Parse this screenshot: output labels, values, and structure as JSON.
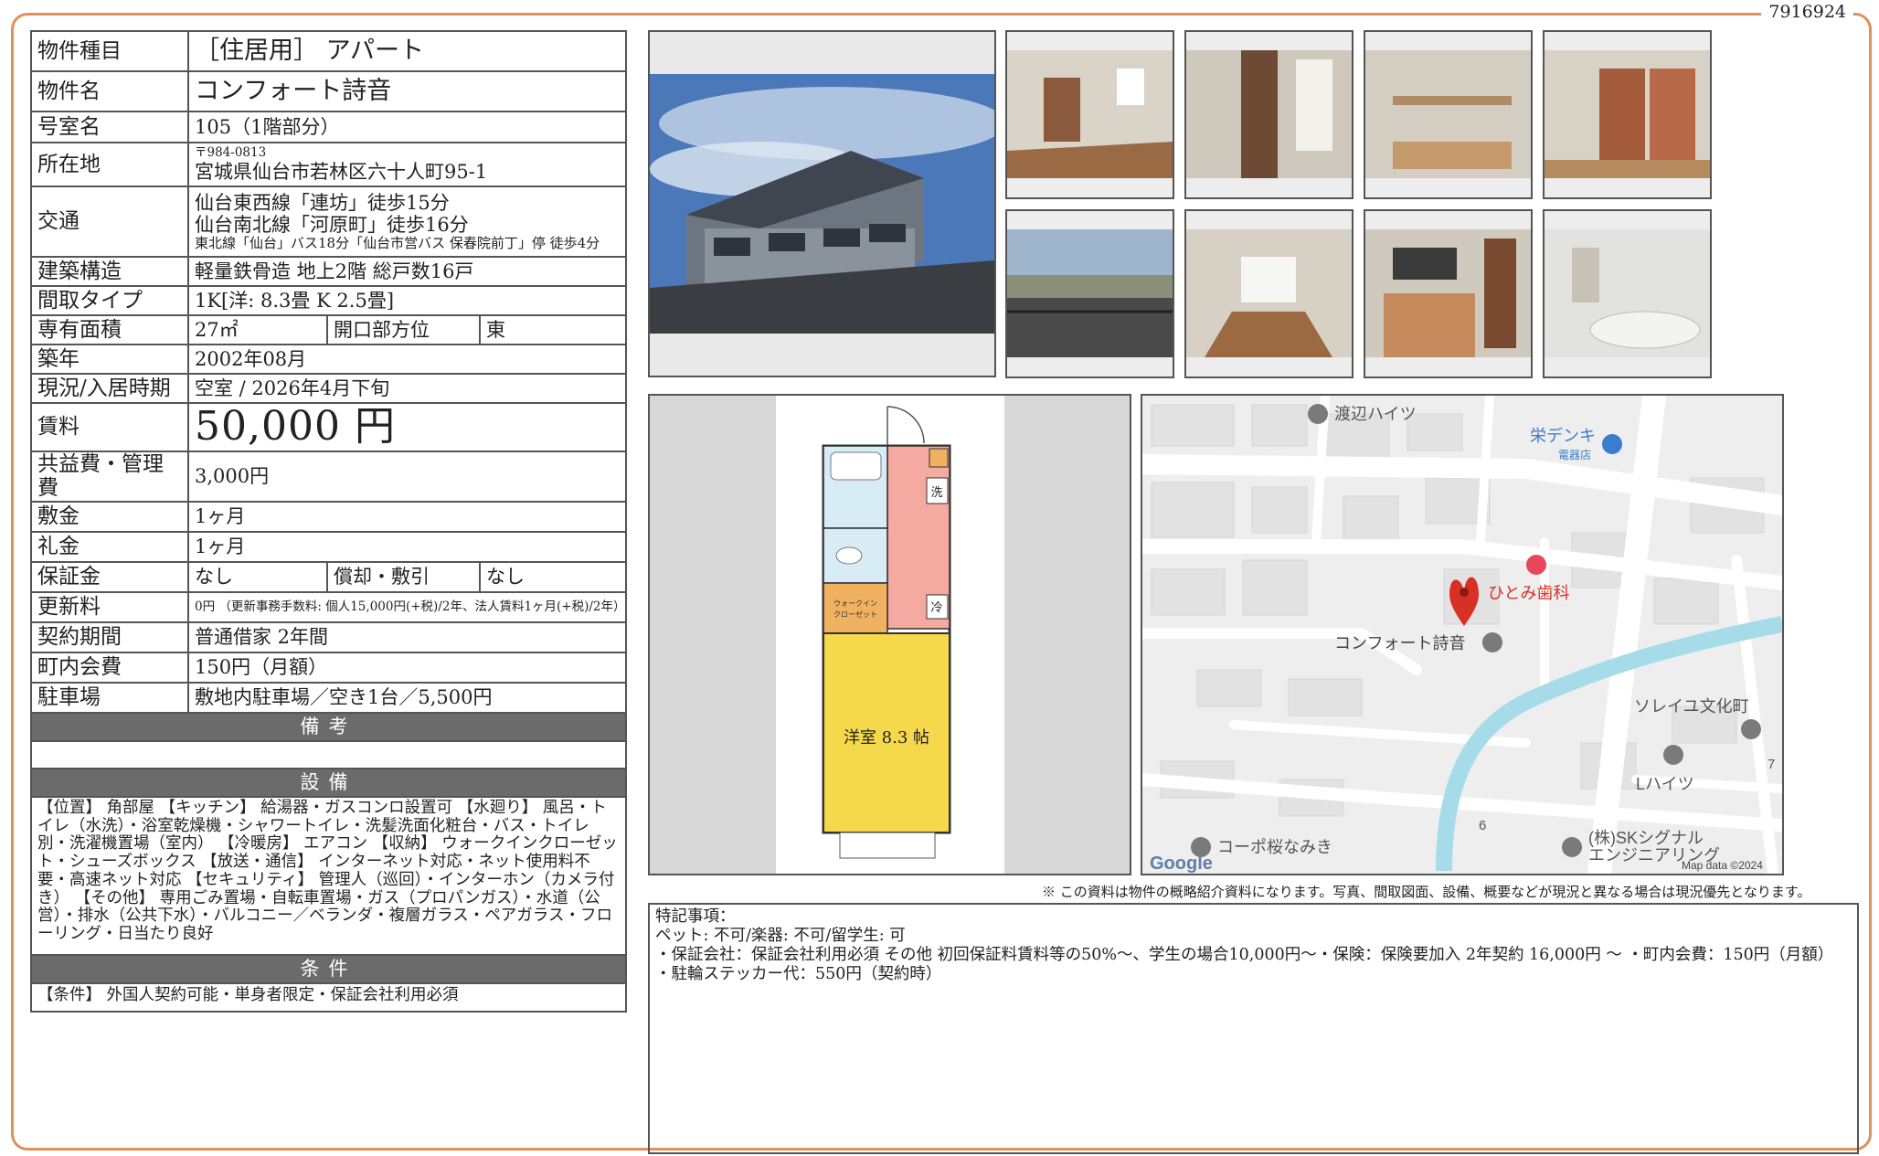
{
  "doc_id": "7916924",
  "rows": {
    "type": {
      "label": "物件種目",
      "value": "［住居用］ アパート"
    },
    "name": {
      "label": "物件名",
      "value": "コンフォート詩音"
    },
    "room": {
      "label": "号室名",
      "value": "105（1階部分）"
    },
    "address": {
      "label": "所在地",
      "postal": "〒984-0813",
      "value": "宮城県仙台市若林区六十人町95-1"
    },
    "access": {
      "label": "交通",
      "line1": "仙台東西線「連坊」徒歩15分",
      "line2": "仙台南北線「河原町」徒歩16分",
      "line3": "東北線「仙台」バス18分「仙台市営バス 保春院前丁」停 徒歩4分"
    },
    "structure": {
      "label": "建築構造",
      "value": "軽量鉄骨造 地上2階 総戸数16戸"
    },
    "layout": {
      "label": "間取タイプ",
      "value": "1K[洋: 8.3畳 K 2.5畳]"
    },
    "area": {
      "label": "専有面積",
      "value": "27㎡",
      "dir_label": "開口部方位",
      "dir_value": "東"
    },
    "built": {
      "label": "築年",
      "value": "2002年08月"
    },
    "status": {
      "label": "現況/入居時期",
      "value": "空室 / 2026年4月下旬"
    },
    "rent": {
      "label": "賃料",
      "value": "50,000 円"
    },
    "fee": {
      "label": "共益費・管理費",
      "value": "3,000円"
    },
    "deposit": {
      "label": "敷金",
      "value": "1ヶ月"
    },
    "key_money": {
      "label": "礼金",
      "value": "1ヶ月"
    },
    "guarantee": {
      "label": "保証金",
      "value": "なし",
      "amort_label": "償却・敷引",
      "amort_value": "なし"
    },
    "renewal": {
      "label": "更新料",
      "value": "0円 （更新事務手数料: 個人15,000円(+税)/2年、法人賃料1ヶ月(+税)/2年）"
    },
    "contract": {
      "label": "契約期間",
      "value": "普通借家 2年間"
    },
    "town_fee": {
      "label": "町内会費",
      "value": "150円（月額）"
    },
    "parking": {
      "label": "駐車場",
      "value": "敷地内駐車場／空き1台／5,500円"
    }
  },
  "sections": {
    "notes": "備考",
    "equipment": "設備",
    "conditions": "条件"
  },
  "equipment_text": "【位置】 角部屋 【キッチン】 給湯器・ガスコンロ設置可 【水廻り】 風呂・トイレ（水洗）・浴室乾燥機・シャワートイレ・洗髪洗面化粧台・バス・トイレ別・洗濯機置場（室内） 【冷暖房】 エアコン 【収納】 ウォークインクローゼット・シューズボックス 【放送・通信】 インターネット対応・ネット使用料不要・高速ネット対応 【セキュリティ】 管理人（巡回）・インターホン（カメラ付き） 【その他】 専用ごみ置場・自転車置場・ガス（プロパンガス）・水道（公営）・排水（公共下水）・バルコニー／ベランダ・複層ガラス・ペアガラス・フローリング・日当たり良好",
  "conditions_text": "【条件】 外国人契約可能・単身者限定・保証会社利用必須",
  "floorplan": {
    "room_label": "洋室 8.3 帖",
    "closet_label1": "ウォークイン",
    "closet_label2": "クローゼット",
    "wash_label": "洗",
    "fridge_label": "冷"
  },
  "map": {
    "labels": {
      "watanabe": "渡辺ハイツ",
      "sakae": "栄デンキ",
      "sakae_sub": "電器店",
      "hitomi": "ひとみ歯科",
      "target": "コンフォート詩音",
      "soleil": "ソレイユ文化町",
      "l_heights": "Lハイツ",
      "sakura": "コーポ桜なみき",
      "sk1": "(株)SKシグナル",
      "sk2": "エンジニアリング",
      "num6": "6",
      "num7": "7",
      "google": "Google",
      "mapdata": "Map data ©2024"
    }
  },
  "disclaimer": "※ この資料は物件の概略紹介資料になります。写真、間取図面、設備、概要などが現況と異なる場合は現況優先となります。",
  "special": {
    "title": "特記事項：",
    "line1": "ペット: 不可/楽器: 不可/留学生: 可",
    "line2": "・保証会社：保証会社利用必須 その他 初回保証料賃料等の50%〜、学生の場合10,000円〜・保険：保険要加入 2年契約 16,000円 〜 ・町内会費：150円（月額）",
    "line3": "・駐輪ステッカー代：550円（契約時）"
  }
}
